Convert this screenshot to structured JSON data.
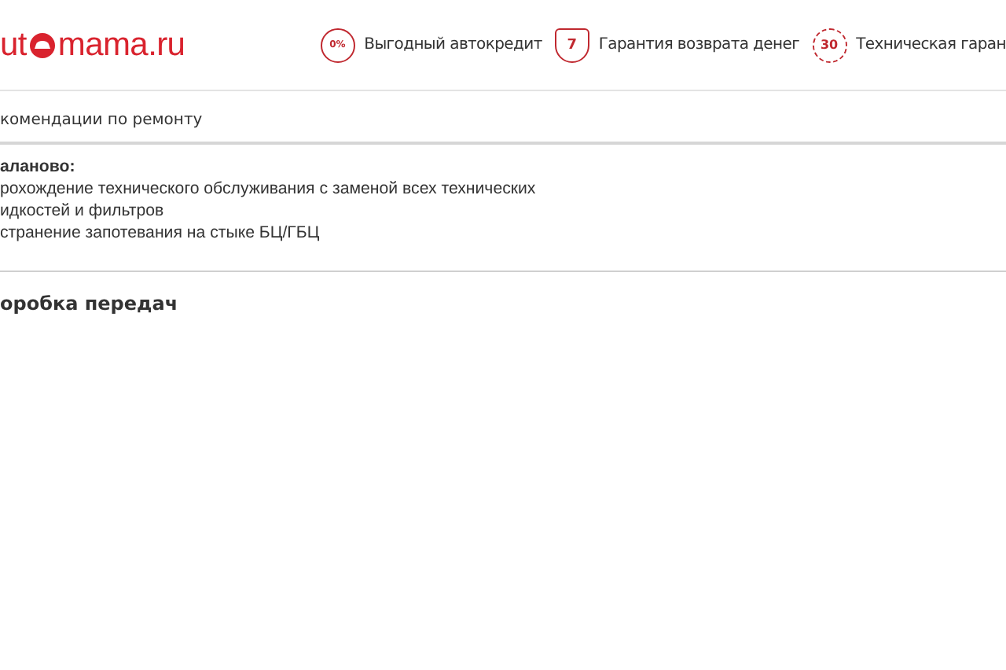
{
  "header": {
    "logo": {
      "before": "ut",
      "after": "mama.ru"
    },
    "benefits": [
      {
        "kind": "percent",
        "badge": "0%",
        "label": "Выгодный автокредит"
      },
      {
        "kind": "shield",
        "badge": "7",
        "label": "Гарантия возврата денег"
      },
      {
        "kind": "seal",
        "badge": "30",
        "label": "Техническая гаран"
      }
    ]
  },
  "recommendations": {
    "title": "комендации по ремонту",
    "lines": [
      {
        "text": "аланово:",
        "bold": true
      },
      {
        "text": "рохождение технического обслуживания с заменой всех технических",
        "bold": false
      },
      {
        "text": "идкостей и фильтров",
        "bold": false
      },
      {
        "text": "странение запотевания на стыке БЦ/ГБЦ",
        "bold": false
      }
    ]
  },
  "next_section": {
    "title": "оробка передач"
  }
}
